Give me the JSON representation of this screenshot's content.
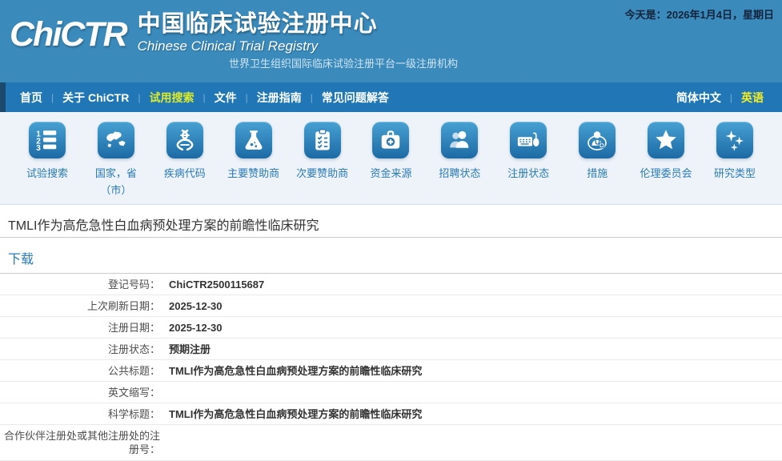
{
  "header": {
    "logo_text": "ChiCTR",
    "title_cn": "中国临床试验注册中心",
    "title_en": "Chinese Clinical Trial Registry",
    "subtitle": "世界卫生组织国际临床试验注册平台一级注册机构",
    "date_text": "今天是：2026年1月4日，星期日"
  },
  "nav": {
    "items": [
      {
        "label": "首页"
      },
      {
        "label": "关于 ChiCTR"
      },
      {
        "label": "试用搜索",
        "active": true
      },
      {
        "label": "文件"
      },
      {
        "label": "注册指南"
      },
      {
        "label": "常见问题解答"
      }
    ],
    "lang": [
      {
        "label": "简体中文"
      },
      {
        "label": "英语",
        "active": true
      }
    ]
  },
  "quicklinks": [
    {
      "label": "试验搜索",
      "icon": "numbered-list-icon"
    },
    {
      "label": "国家，省\n（市）",
      "icon": "world-map-icon"
    },
    {
      "label": "疾病代码",
      "icon": "dna-icon"
    },
    {
      "label": "主要赞助商",
      "icon": "flask-icon"
    },
    {
      "label": "次要赞助商",
      "icon": "clipboard-checklist-icon"
    },
    {
      "label": "资金来源",
      "icon": "medical-bag-icon"
    },
    {
      "label": "招聘状态",
      "icon": "people-icon"
    },
    {
      "label": "注册状态",
      "icon": "keyboard-mouse-icon"
    },
    {
      "label": "措施",
      "icon": "doctor-icon"
    },
    {
      "label": "伦理委员会",
      "icon": "star-icon"
    },
    {
      "label": "研究类型",
      "icon": "sparkles-icon"
    }
  ],
  "main": {
    "page_title": "TMLI作为高危急性白血病预处理方案的前瞻性临床研究",
    "download_label": "下载",
    "fields": [
      {
        "label": "登记号码：",
        "value": "ChiCTR2500115687"
      },
      {
        "label": "上次刷新日期：",
        "value": "2025-12-30"
      },
      {
        "label": "注册日期：",
        "value": "2025-12-30"
      },
      {
        "label": "注册状态：",
        "value": "预期注册"
      },
      {
        "label": "公共标题：",
        "value": "TMLI作为高危急性白血病预处理方案的前瞻性临床研究"
      },
      {
        "label": "英文缩写：",
        "value": ""
      },
      {
        "label": "科学标题：",
        "value": "TMLI作为高危急性白血病预处理方案的前瞻性临床研究"
      },
      {
        "label": "合作伙伴注册处或其他注册处的注册号：",
        "value": ""
      }
    ]
  },
  "colors": {
    "header_blue": "#3a8abc",
    "nav_blue": "#2177b5",
    "nav_active_yellow": "#dcea2c",
    "lang_active_yellow": "#f2ed25",
    "panel_bg": "#eef3f9",
    "tile_gradient_top": "#47a1d3",
    "tile_gradient_bottom": "#1c6aa5",
    "link_blue": "#2b7ab9",
    "label_grey": "#4d4d4d",
    "value_dark": "#333333"
  }
}
